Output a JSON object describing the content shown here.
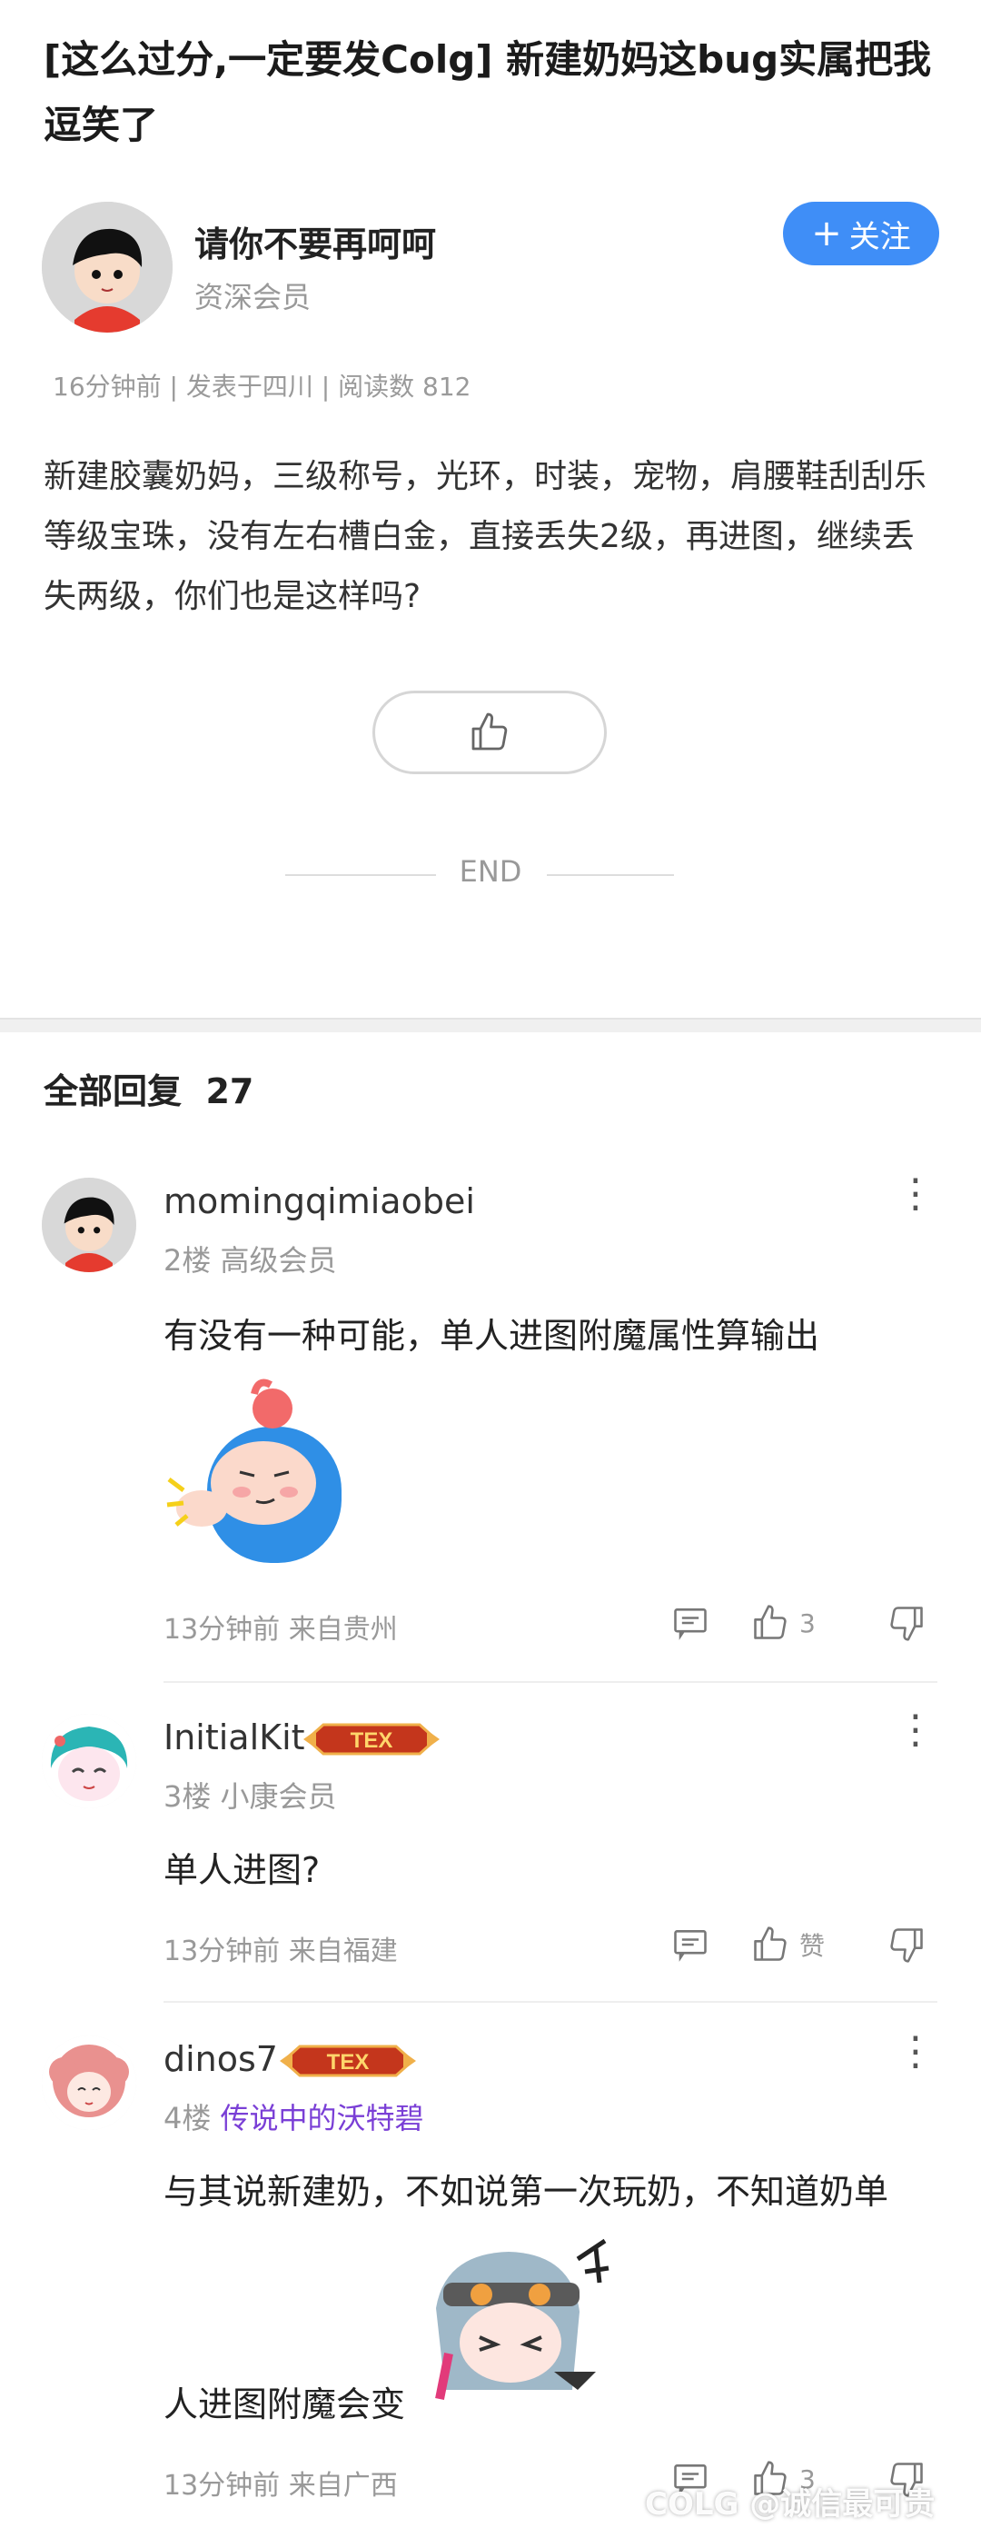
{
  "post": {
    "title": "[这么过分,一定要发Colg] 新建奶妈这bug实属把我逗笑了",
    "author_name": "请你不要再呵呵",
    "author_level": "资深会员",
    "follow_label": "关注",
    "meta": "16分钟前 | 发表于四川 | 阅读数 812",
    "body": "新建胶囊奶妈，三级称号，光环，时装，宠物，肩腰鞋刮刮乐等级宝珠，没有左右槽白金，直接丢失2级，再进图，继续丢失两级，你们也是这样吗?",
    "end_label": "END"
  },
  "replies": {
    "header": "全部回复",
    "count": "27"
  },
  "comments": [
    {
      "name": "momingqimiaobei",
      "floor": "2楼",
      "level": "高级会员",
      "text": "有没有一种可能，单人进图附魔属性算输出",
      "time": "13分钟前 来自贵州",
      "likes": "3"
    },
    {
      "name": "InitialKit",
      "badge": "TEX",
      "floor": "3楼",
      "level": "小康会员",
      "text": "单人进图?",
      "time": "13分钟前 来自福建",
      "likes": "赞"
    },
    {
      "name": "dinos7",
      "badge": "TEX",
      "floor": "4楼",
      "level": "传说中的沃特碧",
      "text_line1": "与其说新建奶，不如说第一次玩奶，不知道奶单",
      "text_line2": "人进图附魔会变",
      "time": "13分钟前 来自广西",
      "likes": "3"
    }
  ],
  "watermark": "COLG @诚信最可贵",
  "colors": {
    "accent": "#3f8ef7",
    "level_highlight": "#7a3fd6",
    "muted": "#999999"
  }
}
